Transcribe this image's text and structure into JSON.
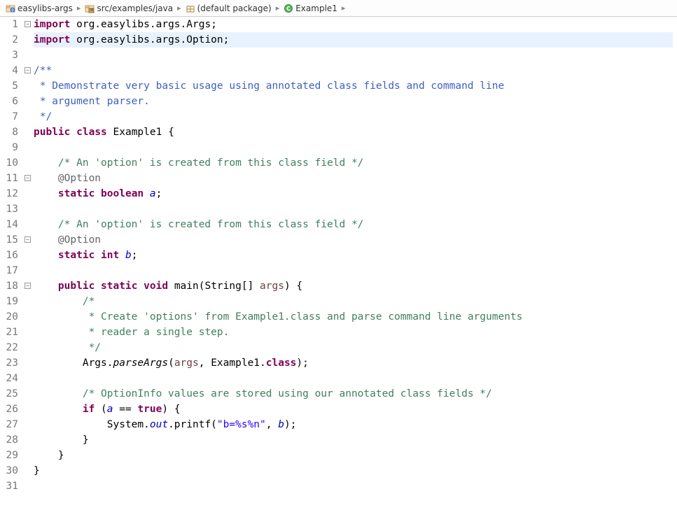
{
  "breadcrumb": [
    {
      "icon": "project",
      "label": "easylibs-args"
    },
    {
      "icon": "src-folder",
      "label": "src/examples/java"
    },
    {
      "icon": "package",
      "label": "(default package)"
    },
    {
      "icon": "class-runnable",
      "label": "Example1"
    },
    {
      "icon": "",
      "label": ""
    }
  ],
  "sep": "▸",
  "lines": [
    {
      "n": "1",
      "fold": "-",
      "segs": [
        [
          "kw",
          "import"
        ],
        [
          "norm",
          " org.easylibs.args.Args;"
        ]
      ]
    },
    {
      "n": "2",
      "hl": true,
      "segs": [
        [
          "kw",
          "import"
        ],
        [
          "norm",
          " org.easylibs.args.Option;"
        ]
      ]
    },
    {
      "n": "3",
      "segs": []
    },
    {
      "n": "4",
      "fold": "-",
      "segs": [
        [
          "jdoc",
          "/**"
        ]
      ]
    },
    {
      "n": "5",
      "segs": [
        [
          "jdoc",
          " * Demonstrate very basic usage using annotated class fields and command line"
        ]
      ]
    },
    {
      "n": "6",
      "segs": [
        [
          "jdoc",
          " * argument parser."
        ]
      ]
    },
    {
      "n": "7",
      "segs": [
        [
          "jdoc",
          " */"
        ]
      ]
    },
    {
      "n": "8",
      "segs": [
        [
          "kw",
          "public"
        ],
        [
          "norm",
          " "
        ],
        [
          "kw",
          "class"
        ],
        [
          "norm",
          " Example1 {"
        ]
      ]
    },
    {
      "n": "9",
      "segs": []
    },
    {
      "n": "10",
      "segs": [
        [
          "norm",
          "    "
        ],
        [
          "com",
          "/* An 'option' is created from this class field */"
        ]
      ]
    },
    {
      "n": "11",
      "fold": "-",
      "segs": [
        [
          "norm",
          "    "
        ],
        [
          "ann",
          "@Option"
        ]
      ]
    },
    {
      "n": "12",
      "segs": [
        [
          "norm",
          "    "
        ],
        [
          "kw",
          "static"
        ],
        [
          "norm",
          " "
        ],
        [
          "kw",
          "boolean"
        ],
        [
          "norm",
          " "
        ],
        [
          "field-it",
          "a"
        ],
        [
          "norm",
          ";"
        ]
      ]
    },
    {
      "n": "13",
      "segs": []
    },
    {
      "n": "14",
      "segs": [
        [
          "norm",
          "    "
        ],
        [
          "com",
          "/* An 'option' is created from this class field */"
        ]
      ]
    },
    {
      "n": "15",
      "fold": "-",
      "segs": [
        [
          "norm",
          "    "
        ],
        [
          "ann",
          "@Option"
        ]
      ]
    },
    {
      "n": "16",
      "segs": [
        [
          "norm",
          "    "
        ],
        [
          "kw",
          "static"
        ],
        [
          "norm",
          " "
        ],
        [
          "kw",
          "int"
        ],
        [
          "norm",
          " "
        ],
        [
          "field-it",
          "b"
        ],
        [
          "norm",
          ";"
        ]
      ]
    },
    {
      "n": "17",
      "segs": []
    },
    {
      "n": "18",
      "fold": "-",
      "segs": [
        [
          "norm",
          "    "
        ],
        [
          "kw",
          "public"
        ],
        [
          "norm",
          " "
        ],
        [
          "kw",
          "static"
        ],
        [
          "norm",
          " "
        ],
        [
          "kw",
          "void"
        ],
        [
          "norm",
          " main(String[] "
        ],
        [
          "param",
          "args"
        ],
        [
          "norm",
          ") {"
        ]
      ]
    },
    {
      "n": "19",
      "segs": [
        [
          "norm",
          "        "
        ],
        [
          "com",
          "/*"
        ]
      ]
    },
    {
      "n": "20",
      "segs": [
        [
          "norm",
          "        "
        ],
        [
          "com",
          " * Create 'options' from Example1.class and parse command line arguments"
        ]
      ]
    },
    {
      "n": "21",
      "segs": [
        [
          "norm",
          "        "
        ],
        [
          "com",
          " * reader a single step."
        ]
      ]
    },
    {
      "n": "22",
      "segs": [
        [
          "norm",
          "        "
        ],
        [
          "com",
          " */"
        ]
      ]
    },
    {
      "n": "23",
      "segs": [
        [
          "norm",
          "        Args."
        ],
        [
          "static-it",
          "parseArgs"
        ],
        [
          "norm",
          "("
        ],
        [
          "param",
          "args"
        ],
        [
          "norm",
          ", Example1."
        ],
        [
          "kw",
          "class"
        ],
        [
          "norm",
          ");"
        ]
      ]
    },
    {
      "n": "24",
      "segs": []
    },
    {
      "n": "25",
      "segs": [
        [
          "norm",
          "        "
        ],
        [
          "com",
          "/* OptionInfo values are stored using our annotated class fields */"
        ]
      ]
    },
    {
      "n": "26",
      "segs": [
        [
          "norm",
          "        "
        ],
        [
          "kw",
          "if"
        ],
        [
          "norm",
          " ("
        ],
        [
          "field-it",
          "a"
        ],
        [
          "norm",
          " == "
        ],
        [
          "kw",
          "true"
        ],
        [
          "norm",
          ") {"
        ]
      ]
    },
    {
      "n": "27",
      "segs": [
        [
          "norm",
          "            System."
        ],
        [
          "field-it",
          "out"
        ],
        [
          "norm",
          ".printf("
        ],
        [
          "str",
          "\"b=%s%n\""
        ],
        [
          "norm",
          ", "
        ],
        [
          "field-it",
          "b"
        ],
        [
          "norm",
          ");"
        ]
      ]
    },
    {
      "n": "28",
      "segs": [
        [
          "norm",
          "        }"
        ]
      ]
    },
    {
      "n": "29",
      "segs": [
        [
          "norm",
          "    }"
        ]
      ]
    },
    {
      "n": "30",
      "segs": [
        [
          "norm",
          "}"
        ]
      ]
    },
    {
      "n": "31",
      "segs": []
    }
  ]
}
